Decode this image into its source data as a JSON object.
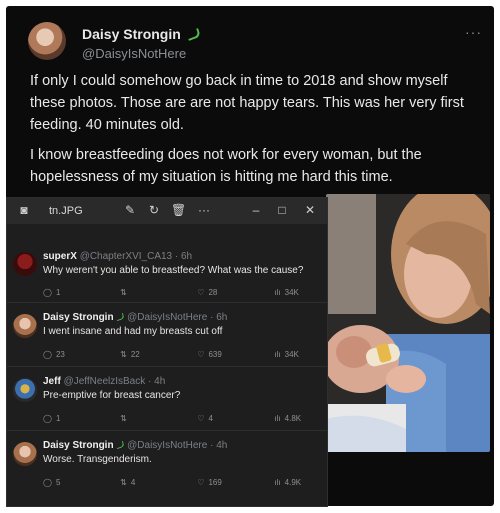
{
  "tweet": {
    "name": "Daisy Strongin",
    "handle": "@DaisyIsNotHere",
    "paragraph1": "If only I could somehow go back in time to 2018 and show myself these photos. Those are are not happy tears. This was her very first feeding. 40 minutes old.",
    "paragraph2": "I know breastfeeding does not work for every woman, but the hopelessness of my situation is hitting me hard this time."
  },
  "window": {
    "filename": "tn.JPG"
  },
  "replies": [
    {
      "name": "superX",
      "handle": "@ChapterXVI_CA13 · 6h",
      "text": "Why weren't you able to breastfeed? What was the cause?",
      "reply": "1",
      "retweet": "",
      "like": "28",
      "views": "34K"
    },
    {
      "name": "Daisy Strongin",
      "handle": "@DaisyIsNotHere · 6h",
      "text": "I went insane and had my breasts cut off",
      "reply": "23",
      "retweet": "22",
      "like": "639",
      "views": "34K"
    },
    {
      "name": "Jeff",
      "handle": "@JeffNeelzIsBack · 4h",
      "text": "Pre-emptive for breast cancer?",
      "reply": "1",
      "retweet": "",
      "like": "4",
      "views": "4.8K"
    },
    {
      "name": "Daisy Strongin",
      "handle": "@DaisyIsNotHere · 4h",
      "text": "Worse. Transgenderism.",
      "reply": "5",
      "retweet": "4",
      "like": "169",
      "views": "4.9K"
    }
  ],
  "colors": {
    "verified": "#4ec04e",
    "background": "#0b0b0b",
    "muted": "#8b8f94"
  }
}
